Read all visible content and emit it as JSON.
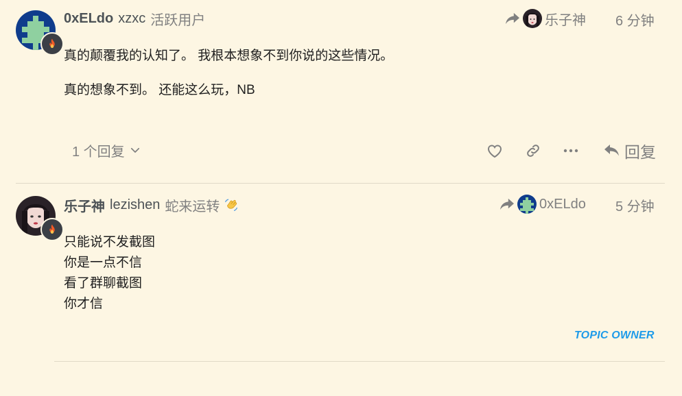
{
  "posts": [
    {
      "username": "0xELdo",
      "full_name": "xzxc",
      "user_title": "活跃用户",
      "reply_to_name": "乐子神",
      "date": "6 分钟",
      "paragraphs": [
        "真的颠覆我的认知了。 我根本想象不到你说的这些情况。",
        "真的想象不到。 还能这么玩，NB"
      ],
      "replies_label": "1 个回复",
      "reply_label": "回复",
      "avatar_icon": "pixel-tree-avatar",
      "badge_icon": "fire-icon"
    },
    {
      "username": "乐子神",
      "full_name": "lezishen",
      "user_title": "蛇来运转",
      "user_title_emoji": "waving-hand-emoji",
      "reply_to_name": "0xELdo",
      "date": "5 分钟",
      "lines": [
        "只能说不发截图",
        "你是一点不信",
        "看了群聊截图",
        "你才信"
      ],
      "topic_owner_label": "TOPIC OWNER",
      "avatar_icon": "anime-girl-avatar",
      "badge_icon": "fire-icon"
    }
  ],
  "colors": {
    "background": "#fdf6e3",
    "text_muted": "#808080",
    "accent_blue": "#1e9be9",
    "divider": "#e0d9c7"
  }
}
